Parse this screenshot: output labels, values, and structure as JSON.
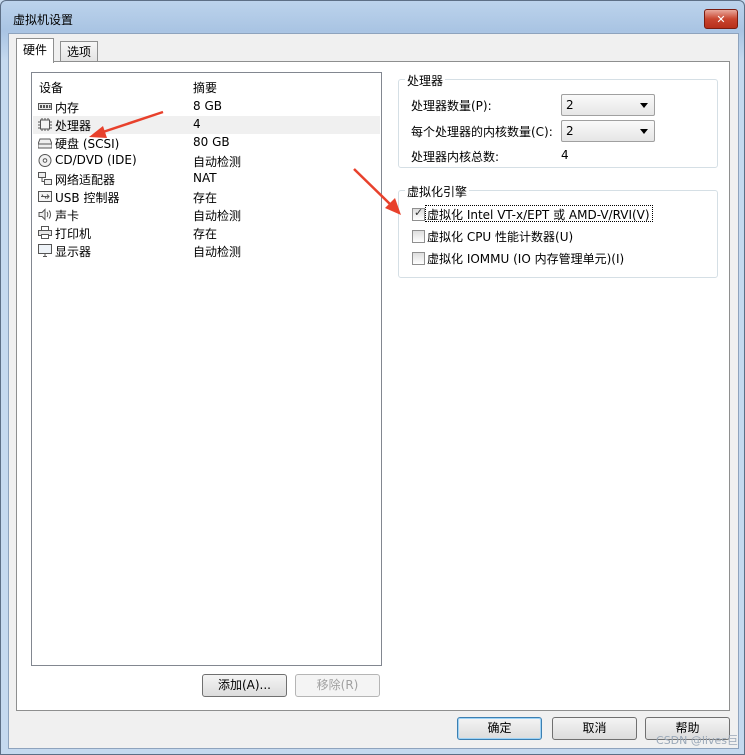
{
  "window": {
    "title": "虚拟机设置",
    "close_symbol": "✕"
  },
  "tabs": [
    {
      "label": "硬件"
    },
    {
      "label": "选项"
    }
  ],
  "device_list": {
    "col_device": "设备",
    "col_summary": "摘要",
    "rows": [
      {
        "name": "内存",
        "value": "8 GB",
        "icon": "memory-icon"
      },
      {
        "name": "处理器",
        "value": "4",
        "icon": "cpu-icon"
      },
      {
        "name": "硬盘 (SCSI)",
        "value": "80 GB",
        "icon": "harddisk-icon"
      },
      {
        "name": "CD/DVD (IDE)",
        "value": "自动检测",
        "icon": "cd-icon"
      },
      {
        "name": "网络适配器",
        "value": "NAT",
        "icon": "network-icon"
      },
      {
        "name": "USB 控制器",
        "value": "存在",
        "icon": "usb-icon"
      },
      {
        "name": "声卡",
        "value": "自动检测",
        "icon": "speaker-icon"
      },
      {
        "name": "打印机",
        "value": "存在",
        "icon": "printer-icon"
      },
      {
        "name": "显示器",
        "value": "自动检测",
        "icon": "monitor-icon"
      }
    ],
    "add_label": "添加(A)...",
    "remove_label": "移除(R)"
  },
  "processor": {
    "group_title": "处理器",
    "count_label": "处理器数量(P):",
    "count_value": "2",
    "cores_label": "每个处理器的内核数量(C):",
    "cores_value": "2",
    "total_label": "处理器内核总数:",
    "total_value": "4"
  },
  "virtualization": {
    "group_title": "虚拟化引擎",
    "opt1": "虚拟化 Intel VT-x/EPT 或 AMD-V/RVI(V)",
    "opt1_checked": true,
    "opt2": "虚拟化 CPU 性能计数器(U)",
    "opt2_checked": false,
    "opt3": "虚拟化 IOMMU (IO 内存管理单元)(I)",
    "opt3_checked": false
  },
  "footer": {
    "ok": "确定",
    "cancel": "取消",
    "help": "帮助"
  },
  "watermark": "CSDN @lives巨",
  "colors": {
    "annotation_arrow": "#e8412c"
  }
}
